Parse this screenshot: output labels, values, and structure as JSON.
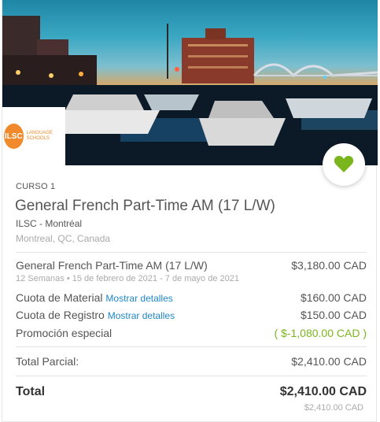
{
  "hero": {
    "image_alt": "Montreal marina at dusk with bridge and lit buildings",
    "logo_text": "ILSC",
    "logo_subtext": "LANGUAGE SCHOOLS",
    "favorite_icon": "heart-icon",
    "accent_green": "#7ab51d"
  },
  "course": {
    "label": "CURSO 1",
    "title": "General French Part-Time AM (17 L/W)",
    "school": "ILSC - Montréal",
    "location": "Montreal, QC, Canada"
  },
  "lines": {
    "course_name": "General French Part-Time AM (17 L/W)",
    "course_price": "$3,180.00 CAD",
    "weeks": "12 Semanas",
    "dates": "15 de febrero de 2021 - 7 de mayo de 2021",
    "material_label": "Cuota de Material",
    "material_link": "Mostrar detalles",
    "material_price": "$160.00 CAD",
    "registration_label": "Cuota de Registro",
    "registration_link": "Mostrar detalles",
    "registration_price": "$150.00 CAD",
    "promo_label": "Promoción especial",
    "promo_price": "( $-1,080.00 CAD )"
  },
  "totals": {
    "subtotal_label": "Total Parcial:",
    "subtotal_value": "$2,410.00 CAD",
    "total_label": "Total",
    "total_value": "$2,410.00 CAD",
    "total_secondary": "$2,410.00 CAD"
  }
}
